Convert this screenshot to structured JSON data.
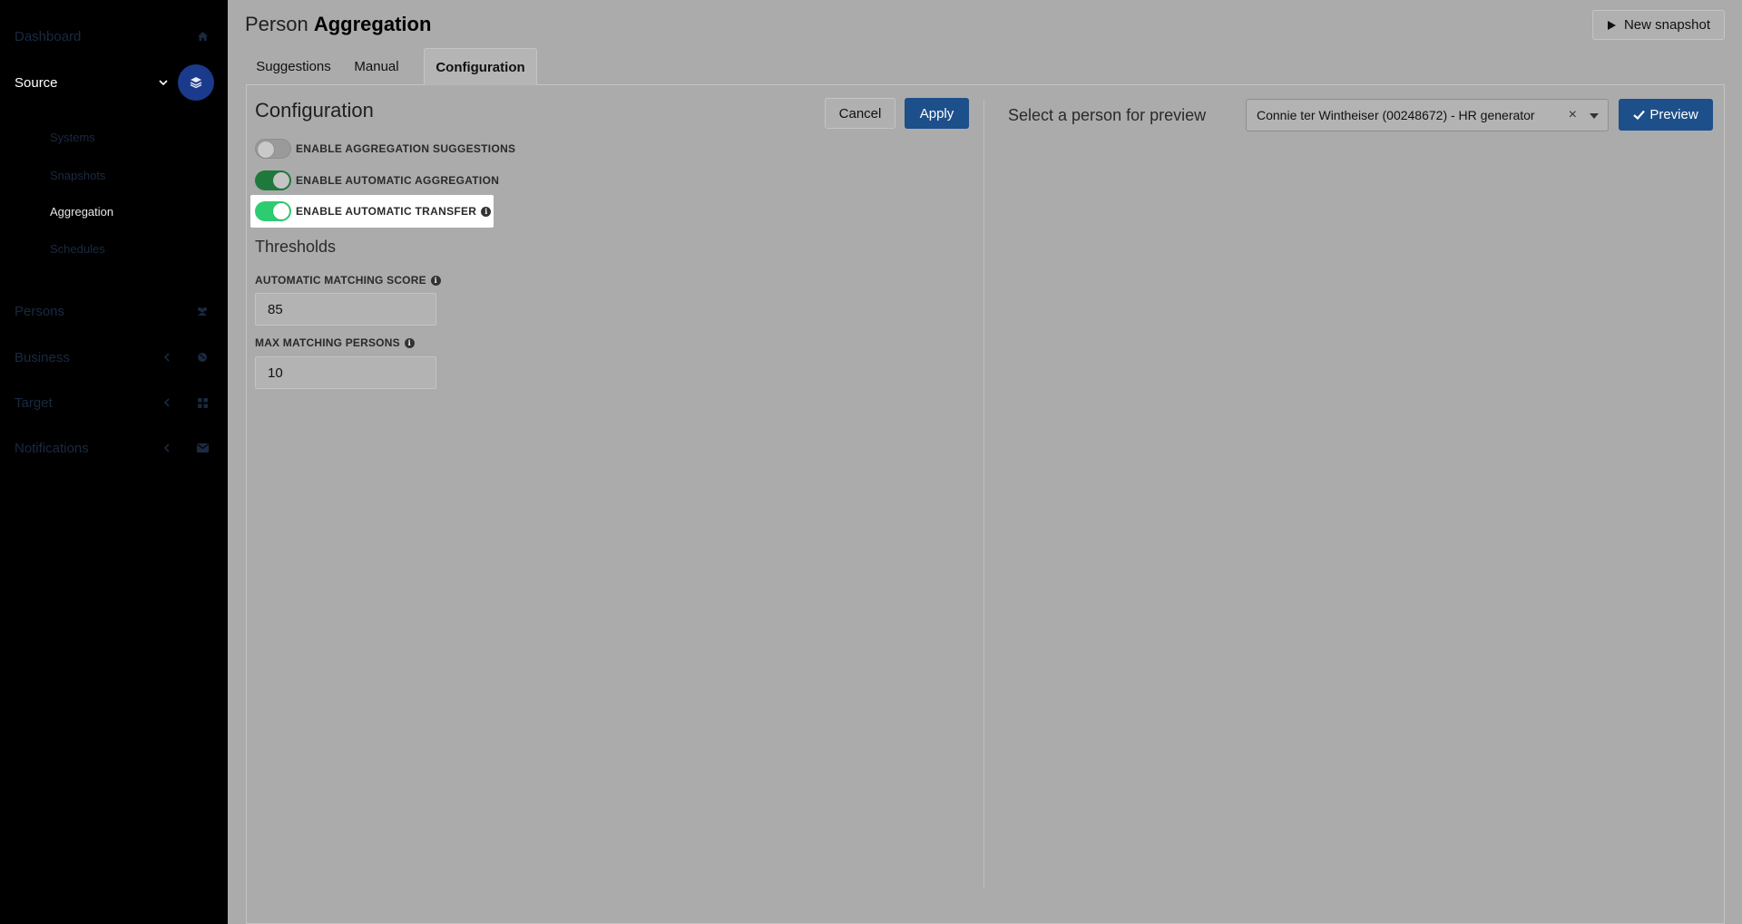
{
  "sidebar": {
    "dashboard": "Dashboard",
    "source": "Source",
    "source_sub": [
      "Systems",
      "Snapshots",
      "Aggregation",
      "Schedules"
    ],
    "persons": "Persons",
    "business": "Business",
    "target": "Target",
    "notifications": "Notifications"
  },
  "header": {
    "title_light": "Person",
    "title_bold": "Aggregation",
    "new_snapshot": "New snapshot"
  },
  "tabs": [
    "Suggestions",
    "Manual",
    "Configuration"
  ],
  "config": {
    "title": "Configuration",
    "cancel": "Cancel",
    "apply": "Apply",
    "toggles": [
      {
        "label": "ENABLE AGGREGATION SUGGESTIONS",
        "state": "off"
      },
      {
        "label": "ENABLE AUTOMATIC AGGREGATION",
        "state": "on"
      },
      {
        "label": "ENABLE AUTOMATIC TRANSFER",
        "state": "on"
      }
    ],
    "thresholds_title": "Thresholds",
    "matching_score_label": "AUTOMATIC MATCHING SCORE",
    "matching_score_value": "85",
    "max_persons_label": "MAX MATCHING PERSONS",
    "max_persons_value": "10"
  },
  "preview": {
    "label": "Select a person for preview",
    "selected": "Connie ter Wintheiser (00248672) - HR generator",
    "button": "Preview"
  },
  "colors": {
    "accent": "#1d4f8a",
    "toggle_on": "#2ecc71",
    "toggle_on_dim": "#1e7a3c"
  }
}
